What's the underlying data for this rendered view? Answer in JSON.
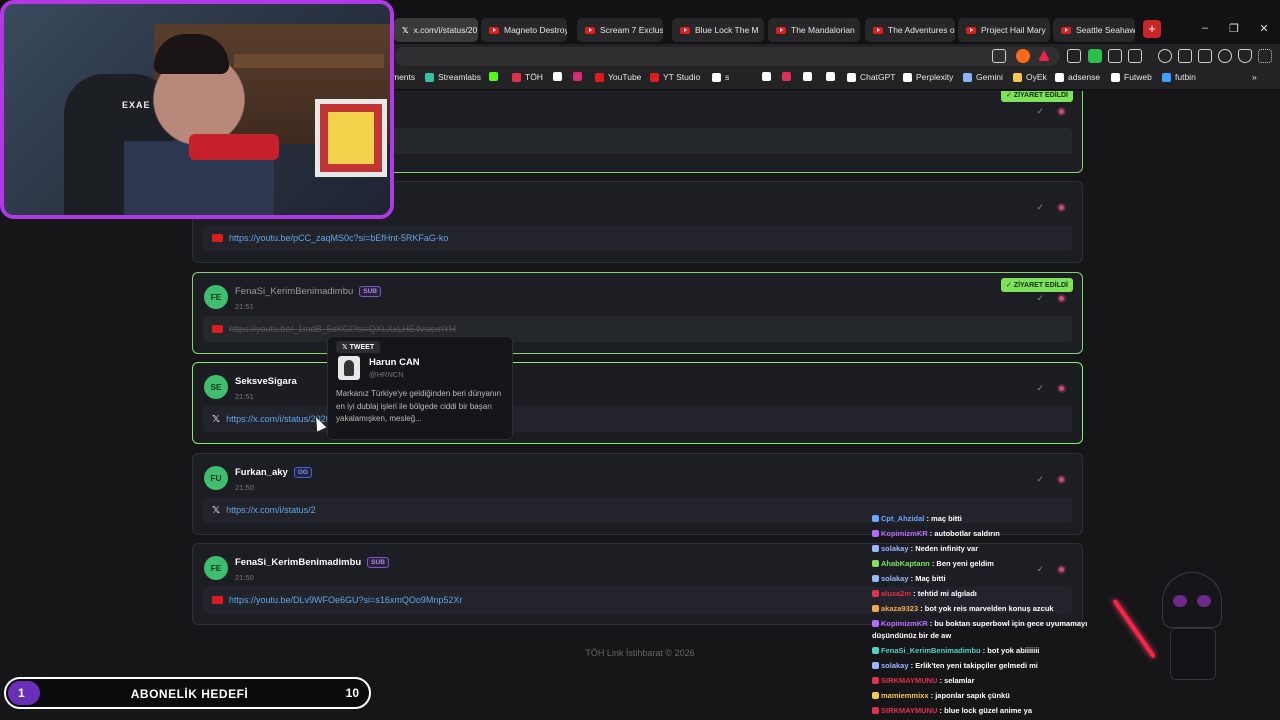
{
  "tabs": [
    {
      "title": "x.com/i/status/20",
      "icon": "x-icon",
      "active": true
    },
    {
      "title": "Magneto Destroy",
      "icon": "youtube-icon"
    },
    {
      "title": "Scream 7 Exclusi",
      "icon": "youtube-icon"
    },
    {
      "title": "Blue Lock The M",
      "icon": "youtube-icon"
    },
    {
      "title": "The Mandalorian",
      "icon": "youtube-icon"
    },
    {
      "title": "The Adventures o",
      "icon": "youtube-icon"
    },
    {
      "title": "Project Hail Mary",
      "icon": "youtube-icon"
    },
    {
      "title": "Seattle Seahawks",
      "icon": "youtube-icon"
    }
  ],
  "window_controls": {
    "minimize": "–",
    "maximize": "❐",
    "close": "✕"
  },
  "bookmarks": [
    {
      "label": "ments",
      "color": "#888"
    },
    {
      "label": "Streamlabs",
      "color": "#31c3a2"
    },
    {
      "label": "",
      "color": "#53fc18"
    },
    {
      "label": "TÖH",
      "color": "#e0304a"
    },
    {
      "label": "",
      "color": "#ffffff"
    },
    {
      "label": "",
      "color": "#d62976"
    },
    {
      "label": "YouTube",
      "color": "#e01b1b"
    },
    {
      "label": "YT Studio",
      "color": "#e01b1b"
    },
    {
      "label": "s",
      "color": "#ffffff"
    },
    {
      "label": "",
      "color": "#ffffff"
    },
    {
      "label": "",
      "color": "#e0305a"
    },
    {
      "label": "",
      "color": "#ffffff"
    },
    {
      "label": "",
      "color": "#ffffff"
    },
    {
      "label": "ChatGPT",
      "color": "#ffffff"
    },
    {
      "label": "Perplexity",
      "color": "#ffffff"
    },
    {
      "label": "Gemini",
      "color": "#8ab4f8"
    },
    {
      "label": "OyEk",
      "color": "#f2c94c"
    },
    {
      "label": "adsense",
      "color": "#ffffff"
    },
    {
      "label": "Futweb",
      "color": "#ffffff"
    },
    {
      "label": "futbin",
      "color": "#3fa0ff"
    }
  ],
  "links": [
    {
      "user": "",
      "badge": "",
      "time": "",
      "url": "...aG9O8PHXbI",
      "source": "x",
      "visited": true,
      "visited_label": "✓ ZİYARET EDİLDİ"
    },
    {
      "user": "",
      "badge": "",
      "time": "",
      "url": "https://youtu.be/pCC_zaqMS0c?si=bEfHnt-5RKFaG-ko",
      "source": "youtube",
      "visited": false
    },
    {
      "user": "FenaSi_KerimBenimadimbu",
      "initials": "FE",
      "badge": "SUB",
      "time": "21:51",
      "url": "https://youtu.be/_1mdB_5oKGI?si=QXLXxLHE4vsiemYH",
      "source": "youtube",
      "visited": true,
      "visited_label": "✓ ZİYARET EDİLDİ"
    },
    {
      "user": "SeksveSigara",
      "initials": "SE",
      "badge": "",
      "time": "21:51",
      "url": "https://x.com/i/status/2020506713288323117",
      "source": "x",
      "visited": false,
      "active": true
    },
    {
      "user": "Furkan_aky",
      "initials": "FU",
      "badge": "OG",
      "time": "21:50",
      "url": "https://x.com/i/status/2",
      "source": "x",
      "visited": false
    },
    {
      "user": "FenaSi_KerimBenimadimbu",
      "initials": "FE",
      "badge": "SUB",
      "time": "21:50",
      "url": "https://youtu.be/DLv9WFOe6GU?si=s16xmQOo9Mnp52Xr",
      "source": "youtube",
      "visited": false
    }
  ],
  "tweet_popup": {
    "tag": "TWEET",
    "name": "Harun CAN",
    "handle": "@HRNCN",
    "text": "Markanız Türkiye'ye geldiğinden beri dünyanın en iyi dublaj işleri ile bölgede ciddi bir başarı yakalamışken, mesleğ..."
  },
  "footer": "TÖH Link İstihbarat © 2026",
  "webcam": {
    "logo": "EXAE"
  },
  "chat": [
    {
      "user": "Cpt_Ahzidal",
      "color": "#6aa9ff",
      "msg": ": maç bitti"
    },
    {
      "user": "KopimizmKR",
      "color": "#b46cff",
      "msg": ": autobotlar saldırın"
    },
    {
      "user": "solakay",
      "color": "#9ab6ff",
      "msg": ": Neden infinity var"
    },
    {
      "user": "AhabKaptann",
      "color": "#7fe35a",
      "msg": ": Ben yeni geldim"
    },
    {
      "user": "solakay",
      "color": "#9ab6ff",
      "msg": ": Maç bitti"
    },
    {
      "user": "aluxa2m",
      "color": "#e0304a",
      "msg": ": tehtid mi algıladı"
    },
    {
      "user": "akaza9323",
      "color": "#f2a94c",
      "msg": ": bot yok reis marvelden konuş azcuk"
    },
    {
      "user": "KopimizmKR",
      "color": "#b46cff",
      "msg": ": bu boktan superbowl için gece uyumamayı düşündünüz bir de aw"
    },
    {
      "user": "FenaSi_KerimBenimadimbu",
      "color": "#4fd1c5",
      "msg": ": bot yok abiiiiiii"
    },
    {
      "user": "solakay",
      "color": "#9ab6ff",
      "msg": ": Erlik'ten yeni takipçiler gelmedi mi"
    },
    {
      "user": "SIRKMAYMUNU",
      "color": "#e0304a",
      "msg": ": selamlar"
    },
    {
      "user": "mamiemmixx",
      "color": "#f2c94c",
      "msg": ": japonlar sapık çünkü"
    },
    {
      "user": "SIRKMAYMUNU",
      "color": "#e0304a",
      "msg": ": blue lock güzel anime ya"
    }
  ],
  "subgoal": {
    "label": "ABONELİK HEDEFİ",
    "current": "1",
    "target": "10",
    "progress": 0.1
  }
}
